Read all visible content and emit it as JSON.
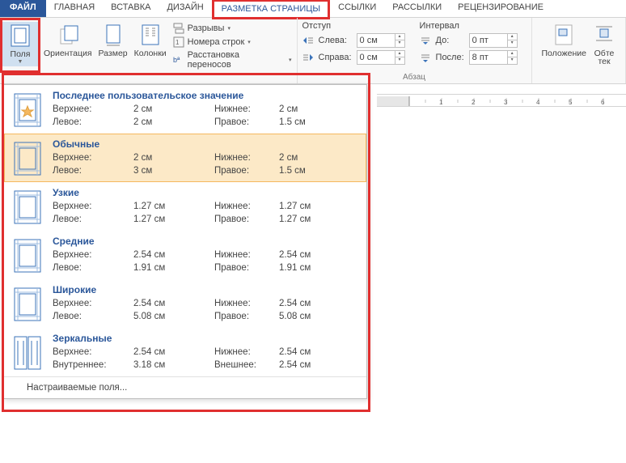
{
  "tabs": {
    "file": "ФАЙЛ",
    "home": "ГЛАВНАЯ",
    "insert": "ВСТАВКА",
    "design": "ДИЗАЙН",
    "layout": "РАЗМЕТКА СТРАНИЦЫ",
    "references": "ССЫЛКИ",
    "mailings": "РАССЫЛКИ",
    "review": "РЕЦЕНЗИРОВАНИЕ"
  },
  "ribbon": {
    "margins": "Поля",
    "orientation": "Ориентация",
    "size": "Размер",
    "columns": "Колонки",
    "breaks": "Разрывы",
    "line_numbers": "Номера строк",
    "hyphenation": "Расстановка переносов",
    "indent_title": "Отступ",
    "left_label": "Слева:",
    "right_label": "Справа:",
    "left_val": "0 см",
    "right_val": "0 см",
    "spacing_title": "Интервал",
    "before_label": "До:",
    "after_label": "После:",
    "before_val": "0 пт",
    "after_val": "8 пт",
    "paragraph_label": "Абзац",
    "position": "Положение",
    "wrap": "Обте",
    "wrap2": "тек"
  },
  "dropdown": {
    "presets": [
      {
        "title": "Последнее пользовательское значение",
        "rows": [
          [
            "Верхнее:",
            "2 см",
            "Нижнее:",
            "2 см"
          ],
          [
            "Левое:",
            "2 см",
            "Правое:",
            "1.5 см"
          ]
        ],
        "star": true
      },
      {
        "title": "Обычные",
        "rows": [
          [
            "Верхнее:",
            "2 см",
            "Нижнее:",
            "2 см"
          ],
          [
            "Левое:",
            "3 см",
            "Правое:",
            "1.5 см"
          ]
        ],
        "selected": true
      },
      {
        "title": "Узкие",
        "rows": [
          [
            "Верхнее:",
            "1.27 см",
            "Нижнее:",
            "1.27 см"
          ],
          [
            "Левое:",
            "1.27 см",
            "Правое:",
            "1.27 см"
          ]
        ]
      },
      {
        "title": "Средние",
        "rows": [
          [
            "Верхнее:",
            "2.54 см",
            "Нижнее:",
            "2.54 см"
          ],
          [
            "Левое:",
            "1.91 см",
            "Правое:",
            "1.91 см"
          ]
        ]
      },
      {
        "title": "Широкие",
        "rows": [
          [
            "Верхнее:",
            "2.54 см",
            "Нижнее:",
            "2.54 см"
          ],
          [
            "Левое:",
            "5.08 см",
            "Правое:",
            "5.08 см"
          ]
        ]
      },
      {
        "title": "Зеркальные",
        "rows": [
          [
            "Верхнее:",
            "2.54 см",
            "Нижнее:",
            "2.54 см"
          ],
          [
            "Внутреннее:",
            "3.18 см",
            "Внешнее:",
            "2.54 см"
          ]
        ],
        "mirror": true
      }
    ],
    "custom": "Настраиваемые поля..."
  }
}
